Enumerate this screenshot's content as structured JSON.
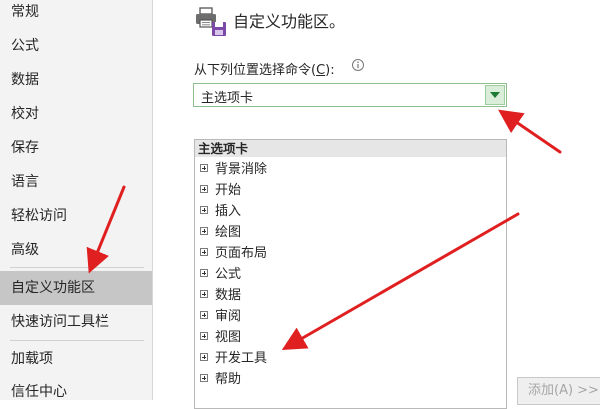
{
  "nav": {
    "items": [
      {
        "label": "常规",
        "selected": false
      },
      {
        "label": "公式",
        "selected": false
      },
      {
        "label": "数据",
        "selected": false
      },
      {
        "label": "校对",
        "selected": false
      },
      {
        "label": "保存",
        "selected": false
      },
      {
        "label": "语言",
        "selected": false
      },
      {
        "label": "轻松访问",
        "selected": false
      },
      {
        "label": "高级",
        "selected": false
      },
      {
        "label": "自定义功能区",
        "selected": true
      },
      {
        "label": "快速访问工具栏",
        "selected": false
      },
      {
        "label": "加载项",
        "selected": false
      },
      {
        "label": "信任中心",
        "selected": false
      }
    ]
  },
  "header": {
    "title": "自定义功能区。",
    "icon": "ribbon-customize-icon"
  },
  "commands": {
    "label_prefix": "从下列位置选择命令(",
    "label_accel": "C",
    "label_suffix": "):",
    "selected": "主选项卡"
  },
  "tree": {
    "header": "主选项卡",
    "items": [
      "背景消除",
      "开始",
      "插入",
      "绘图",
      "页面布局",
      "公式",
      "数据",
      "审阅",
      "视图",
      "开发工具",
      "帮助"
    ]
  },
  "add_button": {
    "label": "添加(A) >>"
  },
  "colors": {
    "annotation_arrow": "#e02020",
    "selected_nav": "#c6c6c6",
    "dropdown_accent": "#1e7b34"
  }
}
